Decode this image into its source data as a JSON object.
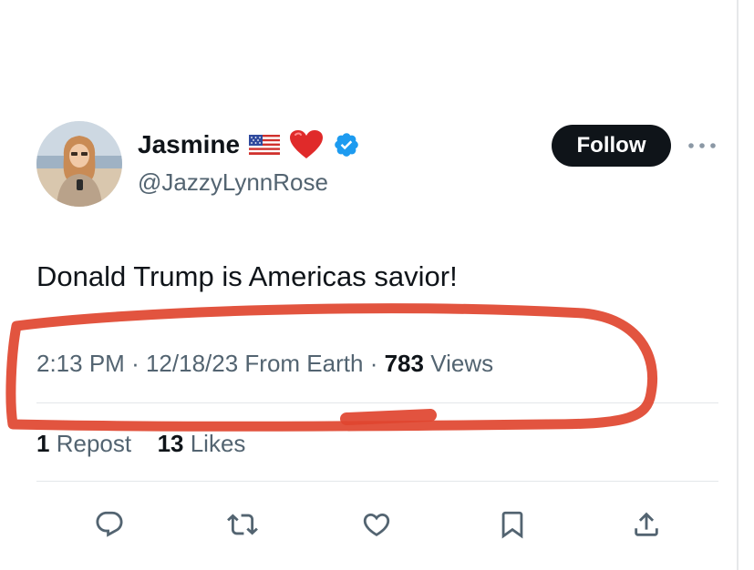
{
  "user": {
    "display_name": "Jasmine",
    "handle": "@JazzyLynnRose",
    "verified": true,
    "name_emoji": [
      "us-flag-emoji",
      "red-heart-emoji"
    ]
  },
  "follow_button": {
    "label": "Follow"
  },
  "tweet": {
    "text": "Donald Trump is Americas savior!",
    "time": "2:13 PM",
    "separator": "·",
    "date": "12/18/23",
    "source": "From Earth",
    "views_count": "783",
    "views_label": "Views"
  },
  "stats": {
    "reposts_count": "1",
    "reposts_label": "Repost",
    "likes_count": "13",
    "likes_label": "Likes"
  },
  "actions": [
    "reply-icon",
    "repost-icon",
    "like-icon",
    "bookmark-icon",
    "share-icon"
  ],
  "colors": {
    "text_primary": "#0f1419",
    "text_secondary": "#536471",
    "verified_blue": "#1d9bf0",
    "annotation_red": "#e0452f",
    "divider": "#e3e7ea"
  }
}
